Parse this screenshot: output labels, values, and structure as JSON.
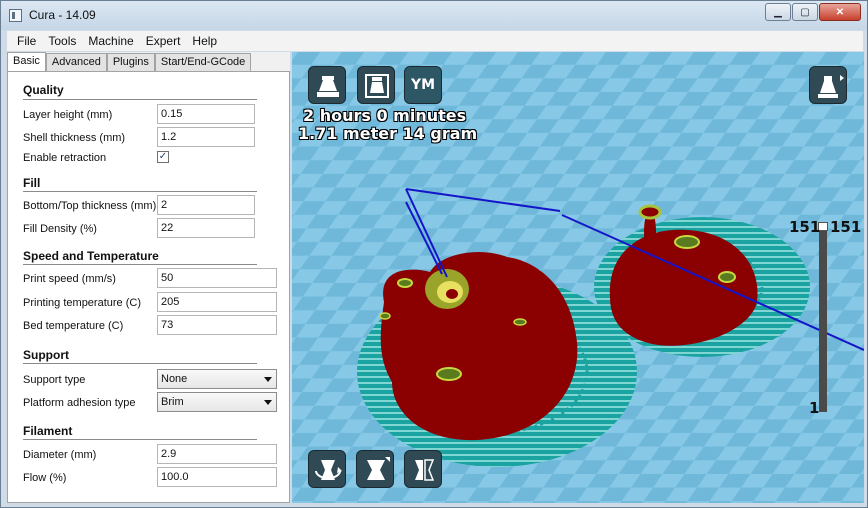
{
  "window": {
    "title": "Cura - 14.09",
    "minimize": "▁",
    "maximize": "▢",
    "close": "✕"
  },
  "menu": [
    "File",
    "Tools",
    "Machine",
    "Expert",
    "Help"
  ],
  "tabs": [
    "Basic",
    "Advanced",
    "Plugins",
    "Start/End-GCode"
  ],
  "quality": {
    "title": "Quality",
    "layer_height_label": "Layer height (mm)",
    "layer_height": "0.15",
    "shell_thickness_label": "Shell thickness (mm)",
    "shell_thickness": "1.2",
    "retraction_label": "Enable retraction",
    "retraction_checked": "✓"
  },
  "fill": {
    "title": "Fill",
    "bottom_top_label": "Bottom/Top thickness (mm)",
    "bottom_top": "2",
    "density_label": "Fill Density (%)",
    "density": "22"
  },
  "speed": {
    "title": "Speed and Temperature",
    "print_speed_label": "Print speed (mm/s)",
    "print_speed": "50",
    "print_temp_label": "Printing temperature (C)",
    "print_temp": "205",
    "bed_temp_label": "Bed temperature (C)",
    "bed_temp": "73"
  },
  "support": {
    "title": "Support",
    "type_label": "Support type",
    "type": "None",
    "adhesion_label": "Platform adhesion type",
    "adhesion": "Brim"
  },
  "filament": {
    "title": "Filament",
    "diameter_label": "Diameter (mm)",
    "diameter": "2.9",
    "flow_label": "Flow (%)",
    "flow": "100.0"
  },
  "viewport": {
    "print_time": "2 hours 0 minutes",
    "material": "1.71 meter 14 gram",
    "ym_label": "YM",
    "layer_max_left": "151",
    "layer_max_right": "151",
    "layer_min": "1",
    "icons": [
      "load-model-icon",
      "save-toolpath-icon",
      "youmagine-icon",
      "view-mode-icon",
      "rotate-icon",
      "scale-icon",
      "mirror-icon"
    ],
    "colors": {
      "bed": "#7fc3e2",
      "model": "#8b0000",
      "brim": "#1aa3a0",
      "travel": "#1515c8"
    }
  }
}
